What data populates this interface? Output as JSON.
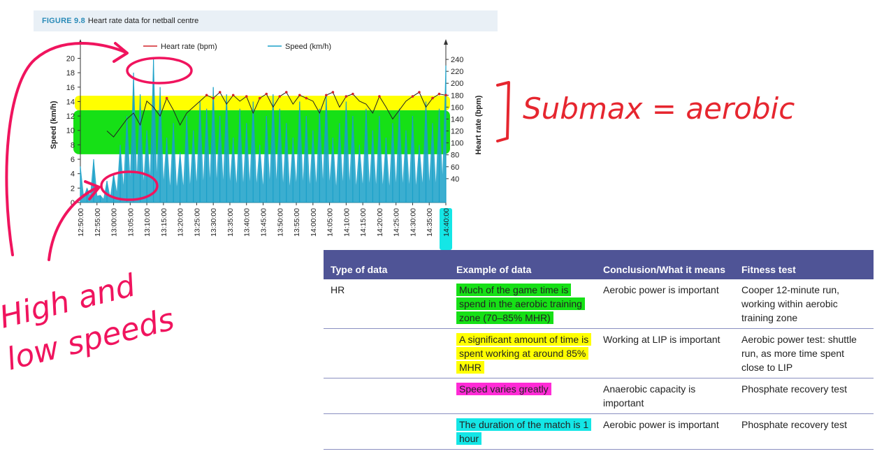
{
  "figure": {
    "number": "FIGURE 9.8",
    "title": "Heart rate data for netball centre"
  },
  "chart_data": {
    "type": "line",
    "legend": [
      "Heart rate (bpm)",
      "Speed (km/h)"
    ],
    "legend_position": "top",
    "left_axis": {
      "label": "Speed (km/h)",
      "ticks": [
        0,
        2,
        4,
        6,
        8,
        10,
        12,
        14,
        16,
        18,
        20
      ],
      "range": [
        0,
        21.5
      ]
    },
    "right_axis": {
      "label": "Heart rate (bpm)",
      "ticks": [
        40,
        60,
        80,
        100,
        120,
        140,
        160,
        180,
        200,
        220,
        240
      ],
      "range": [
        0,
        260
      ]
    },
    "x_ticks": [
      "12:50:00",
      "12:55:00",
      "13:00:00",
      "13:05:00",
      "13:10:00",
      "13:15:00",
      "13:20:00",
      "13:25:00",
      "13:30:00",
      "13:35:00",
      "13:40:00",
      "13:45:00",
      "13:50:00",
      "13:55:00",
      "14:00:00",
      "14:05:00",
      "14:10:00",
      "14:15:00",
      "14:20:00",
      "14:25:00",
      "14:30:00",
      "14:35:00",
      "14:40:00"
    ],
    "series": [
      {
        "name": "Heart rate (bpm)",
        "color": "#d2232a",
        "x": [
          "12:58:00",
          "13:00:00",
          "13:02:00",
          "13:04:00",
          "13:06:00",
          "13:08:00",
          "13:10:00",
          "13:12:00",
          "13:14:00",
          "13:16:00",
          "13:18:00",
          "13:20:00",
          "13:22:00",
          "13:24:00",
          "13:26:00",
          "13:28:00",
          "13:30:00",
          "13:32:00",
          "13:34:00",
          "13:36:00",
          "13:38:00",
          "13:40:00",
          "13:42:00",
          "13:44:00",
          "13:46:00",
          "13:48:00",
          "13:50:00",
          "13:52:00",
          "13:54:00",
          "13:56:00",
          "13:58:00",
          "14:00:00",
          "14:02:00",
          "14:04:00",
          "14:06:00",
          "14:08:00",
          "14:10:00",
          "14:12:00",
          "14:14:00",
          "14:16:00",
          "14:18:00",
          "14:20:00",
          "14:22:00",
          "14:24:00",
          "14:26:00",
          "14:28:00",
          "14:30:00",
          "14:32:00",
          "14:34:00",
          "14:36:00",
          "14:38:00",
          "14:40:00"
        ],
        "values": [
          120,
          110,
          125,
          140,
          150,
          130,
          170,
          160,
          145,
          175,
          155,
          130,
          150,
          160,
          170,
          180,
          175,
          185,
          165,
          180,
          170,
          178,
          150,
          175,
          182,
          160,
          178,
          185,
          165,
          180,
          175,
          170,
          150,
          180,
          185,
          160,
          178,
          182,
          170,
          165,
          150,
          178,
          160,
          140,
          155,
          170,
          178,
          185,
          160,
          175,
          182,
          180
        ]
      },
      {
        "name": "Speed (km/h)",
        "color": "#1aa0c8",
        "x": [
          "12:50:00",
          "12:52:00",
          "12:54:00",
          "12:56:00",
          "12:58:00",
          "13:00:00",
          "13:02:00",
          "13:04:00",
          "13:06:00",
          "13:08:00",
          "13:10:00",
          "13:12:00",
          "13:14:00",
          "13:16:00",
          "13:18:00",
          "13:20:00",
          "13:22:00",
          "13:24:00",
          "13:26:00",
          "13:28:00",
          "13:30:00",
          "13:32:00",
          "13:34:00",
          "13:36:00",
          "13:38:00",
          "13:40:00",
          "13:42:00",
          "13:44:00",
          "13:46:00",
          "13:48:00",
          "13:50:00",
          "13:52:00",
          "13:54:00",
          "13:56:00",
          "13:58:00",
          "14:00:00",
          "14:02:00",
          "14:04:00",
          "14:06:00",
          "14:08:00",
          "14:10:00",
          "14:12:00",
          "14:14:00",
          "14:16:00",
          "14:18:00",
          "14:20:00",
          "14:22:00",
          "14:24:00",
          "14:26:00",
          "14:28:00",
          "14:30:00",
          "14:32:00",
          "14:34:00",
          "14:36:00",
          "14:38:00",
          "14:40:00"
        ],
        "values": [
          5,
          2,
          6,
          1,
          3,
          4,
          8,
          12,
          18,
          15,
          10,
          20,
          16,
          9,
          11,
          7,
          12,
          10,
          14,
          13,
          16,
          12,
          15,
          9,
          13,
          11,
          14,
          8,
          12,
          15,
          13,
          11,
          9,
          14,
          12,
          10,
          13,
          15,
          9,
          11,
          14,
          12,
          8,
          13,
          10,
          12,
          9,
          11,
          13,
          10,
          12,
          8,
          14,
          11,
          13,
          19
        ]
      }
    ]
  },
  "annotations": {
    "submax": "Submax = aerobic",
    "high_low_line1": "High and",
    "high_low_line2": "low speeds"
  },
  "highlight_colors": {
    "green": "#16e016",
    "yellow": "#ffff00",
    "magenta": "#ff2bd6",
    "cyan": "#14e6e6"
  },
  "table": {
    "headers": [
      "Type of data",
      "Example of data",
      "Conclusion/What it means",
      "Fitness test"
    ],
    "rows": [
      {
        "type": "HR",
        "example": "Much of the game time is spend in the aerobic training zone (70–85% MHR)",
        "conclusion": "Aerobic power is important",
        "test": "Cooper 12-minute run, working within aerobic training zone",
        "highlight": "green"
      },
      {
        "type": "",
        "example": "A significant amount of time is spent working at around 85% MHR",
        "conclusion": "Working at LIP is important",
        "test": "Aerobic power test: shuttle run, as more time spent close to LIP",
        "highlight": "yellow"
      },
      {
        "type": "",
        "example": "Speed varies greatly",
        "conclusion": "Anaerobic capacity is important",
        "test": "Phosphate recovery test",
        "highlight": "magenta"
      },
      {
        "type": "",
        "example": "The duration of the match is 1 hour",
        "conclusion": "Aerobic power is important",
        "test": "Phosphate recovery test",
        "highlight": "cyan"
      }
    ]
  }
}
